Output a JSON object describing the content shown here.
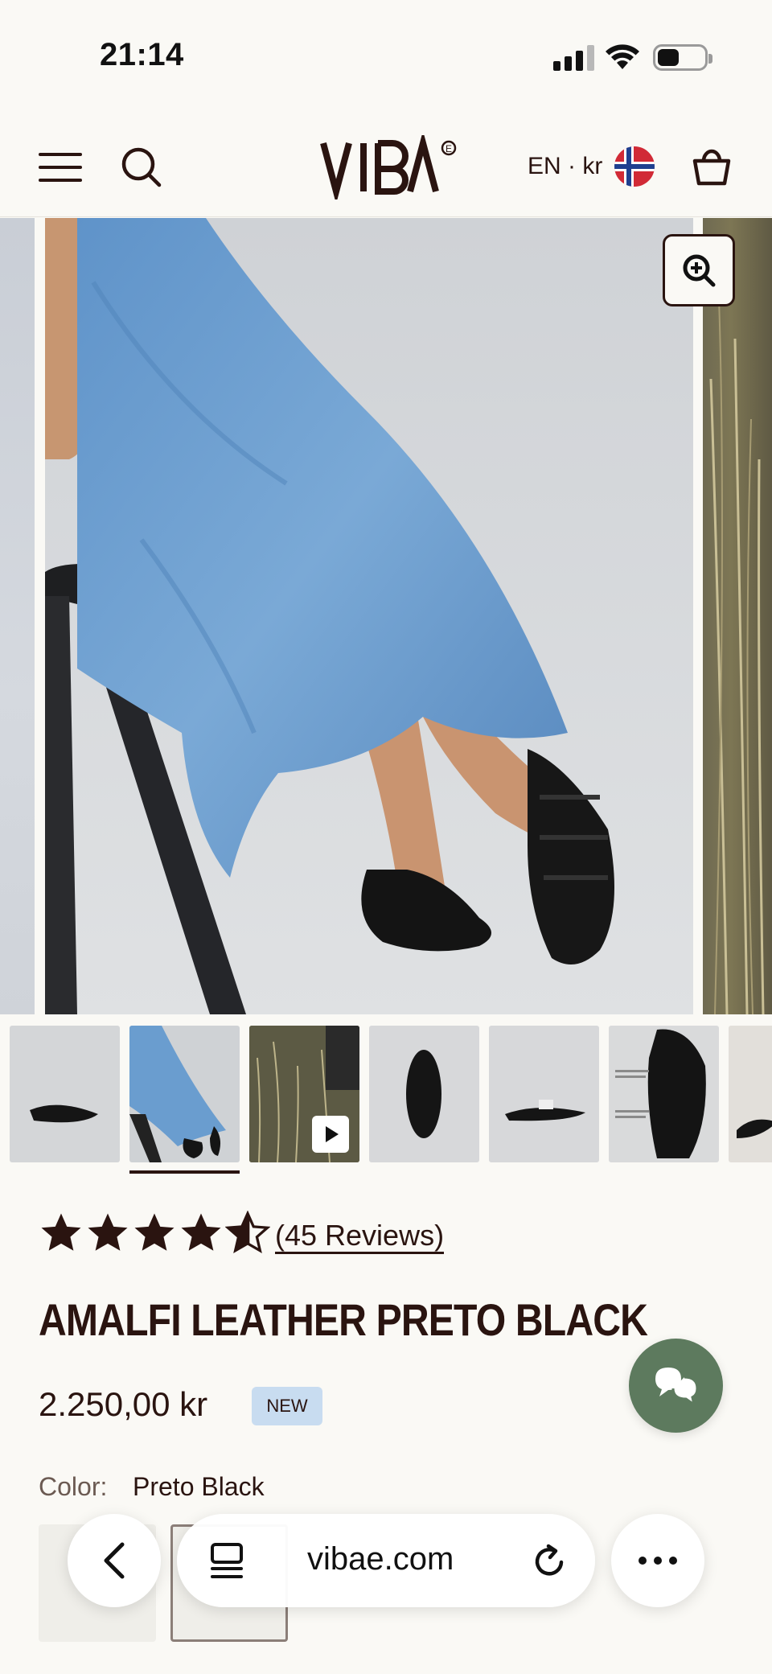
{
  "status_bar": {
    "time": "21:14"
  },
  "header": {
    "logo_text": "VIBA",
    "language_currency": "EN · kr"
  },
  "gallery": {
    "zoom_label": "",
    "thumbnails": [
      {
        "name": "side-view"
      },
      {
        "name": "model-seated"
      },
      {
        "name": "video-outdoor",
        "has_play": true
      },
      {
        "name": "top-view"
      },
      {
        "name": "profile-view"
      },
      {
        "name": "feature-details"
      },
      {
        "name": "pair-view"
      }
    ]
  },
  "product": {
    "rating": 4.5,
    "reviews_label": "(45 Reviews)",
    "title": "AMALFI LEATHER PRETO BLACK",
    "price": "2.250,00 kr",
    "badge": "NEW",
    "color_label": "Color:",
    "color_value": "Preto Black"
  },
  "browser": {
    "url": "vibae.com"
  },
  "colors": {
    "brand": "#2a1410",
    "chat": "#5d7a5e",
    "badge_bg": "#c8dcf0",
    "background": "#faf9f5"
  }
}
